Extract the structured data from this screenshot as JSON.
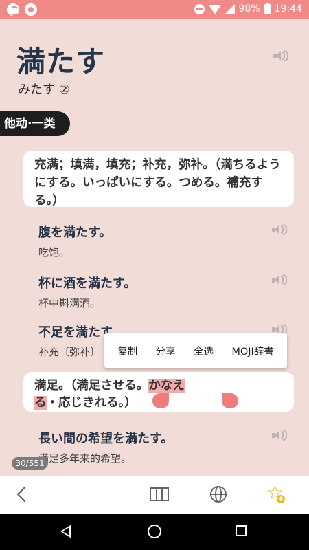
{
  "status_bar": {
    "battery": "98%",
    "time": "19:44"
  },
  "word": {
    "title": "満たす",
    "reading": "みたす ②"
  },
  "pos_tag": "他动·一类",
  "definition_1": "充满；填满，填充；补充，弥补。（満ちるようにする。いっぱいにする。つめる。補充する。）",
  "examples": [
    {
      "jp": "腹を満たす。",
      "zh": "吃饱。"
    },
    {
      "jp": "杯に酒を満たす。",
      "zh": "杯中斟满酒。"
    },
    {
      "jp": "不足を満たす。",
      "zh": "补充〔弥补〕"
    }
  ],
  "definition_2": {
    "before": "満足。（満足させる。",
    "highlight": "かなえる",
    "after": "・応じきれる。）"
  },
  "example_4": {
    "jp": "長い間の希望を満たす。",
    "zh": "满足多年来的希望。"
  },
  "context_menu": {
    "copy": "复制",
    "share": "分享",
    "select_all": "全选",
    "moji": "MOJI辞書"
  },
  "counter": "30/551",
  "icons": {
    "speaker": "speaker-icon",
    "back": "chevron-left-icon",
    "map": "map-icon",
    "globe": "globe-icon",
    "star": "star-add-icon"
  },
  "colors": {
    "status_bar": "#f08a86",
    "background": "#f1dcd8",
    "title": "#273447",
    "highlight": "#f5aaaa",
    "star": "#e5b92c"
  }
}
